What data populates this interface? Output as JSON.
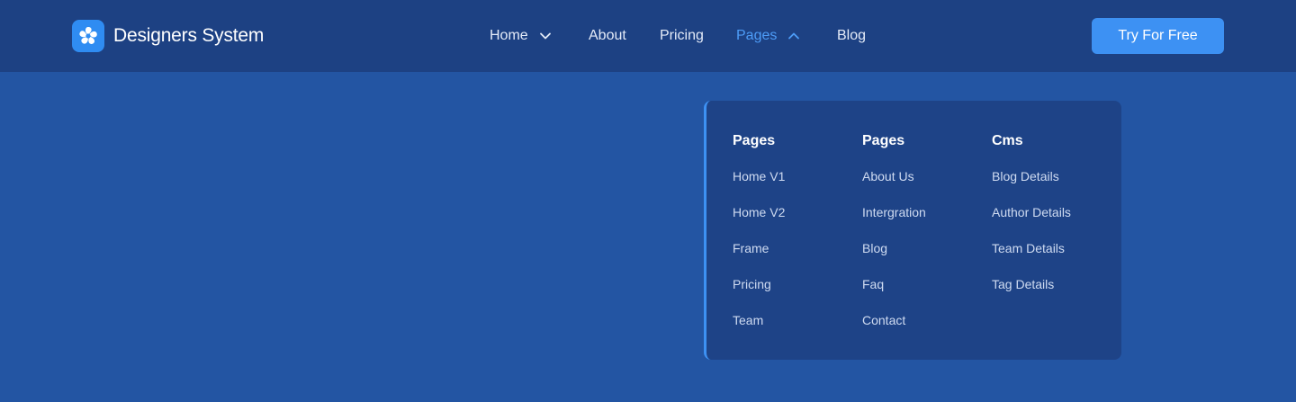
{
  "brand": {
    "name": "Designers System",
    "logo_icon": "swirl-logo-icon"
  },
  "nav": {
    "items": [
      {
        "label": "Home",
        "has_dropdown": true,
        "expanded": false
      },
      {
        "label": "About",
        "has_dropdown": false
      },
      {
        "label": "Pricing",
        "has_dropdown": false
      },
      {
        "label": "Pages",
        "has_dropdown": true,
        "expanded": true,
        "active": true
      },
      {
        "label": "Blog",
        "has_dropdown": false
      }
    ],
    "cta_label": "Try For Free"
  },
  "dropdown": {
    "columns": [
      {
        "heading": "Pages",
        "links": [
          "Home V1",
          "Home V2",
          "Frame",
          "Pricing",
          "Team"
        ]
      },
      {
        "heading": "Pages",
        "links": [
          "About Us",
          "Intergration",
          "Blog",
          "Faq",
          "Contact"
        ]
      },
      {
        "heading": "Cms",
        "links": [
          "Blog Details",
          "Author Details",
          "Team Details",
          "Tag Details"
        ]
      }
    ]
  },
  "colors": {
    "page_bg": "#2355a3",
    "navbar_bg": "#1d4183",
    "accent": "#3d91f3",
    "active_link": "#4d9cf7",
    "dropdown_bg": "#1e4387"
  }
}
